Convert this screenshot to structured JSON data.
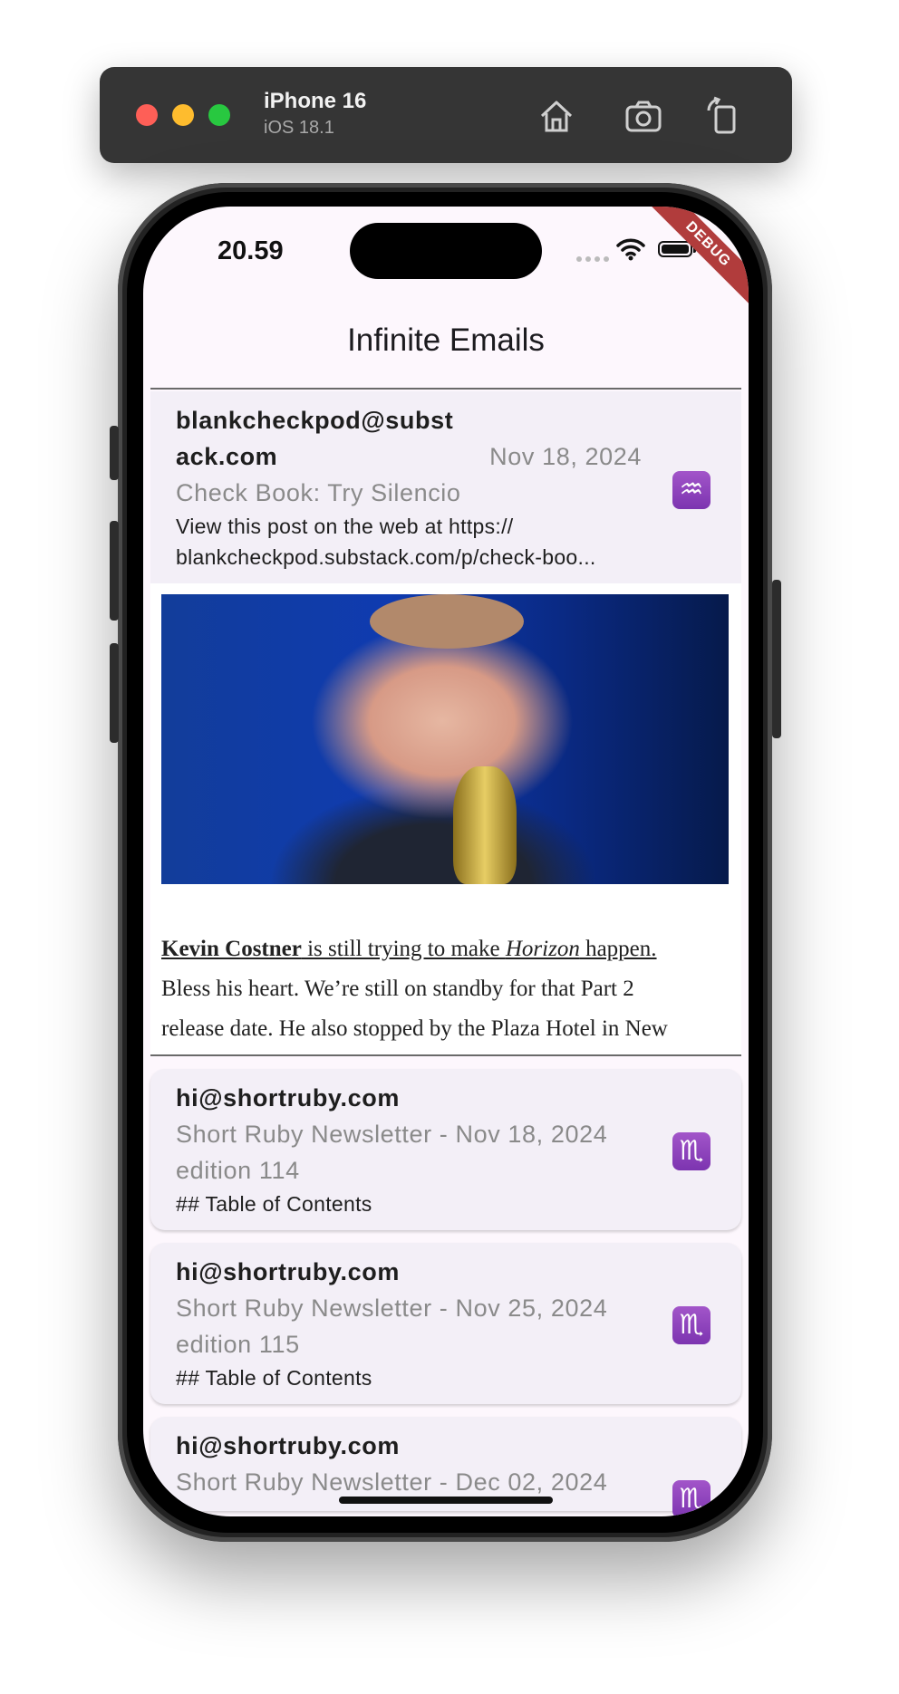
{
  "simulator": {
    "device": "iPhone 16",
    "os": "iOS 18.1"
  },
  "status_bar": {
    "time": "20.59",
    "debug_label": "DEBUG"
  },
  "app": {
    "title": "Infinite Emails"
  },
  "emails": [
    {
      "sender_line1": "blankcheckpod@subst",
      "sender_line2": "ack.com",
      "date": "Nov 18, 2024",
      "subject": "Check Book: Try Silencio",
      "preview_line1": "View this post on the web at https://",
      "preview_line2": "blankcheckpod.substack.com/p/check-boo...",
      "zodiac": "♒",
      "zodiac_icon": "aquarius-icon",
      "expanded": true,
      "article": {
        "strong_link": "Kevin Costner",
        "link_mid": " is still trying to make ",
        "em_link": "Horizon",
        "link_end": " happen.",
        "rest_line1": "Bless his heart. We’re still on standby for that Part 2",
        "rest_line2": "release date. He also stopped by the Plaza Hotel in New"
      }
    },
    {
      "sender": "hi@shortruby.com",
      "subject_line1": "Short Ruby Newsletter - Nov 18, 2024",
      "subject_line2": "edition 114",
      "preview": "## Table of Contents",
      "zodiac": "♏",
      "zodiac_icon": "scorpio-icon"
    },
    {
      "sender": "hi@shortruby.com",
      "subject_line1": "Short Ruby Newsletter - Nov 25, 2024",
      "subject_line2": "edition 115",
      "preview": "## Table of Contents",
      "zodiac": "♏",
      "zodiac_icon": "scorpio-icon"
    },
    {
      "sender": "hi@shortruby.com",
      "subject_line1": "Short Ruby Newsletter - Dec 02, 2024",
      "zodiac": "♏",
      "zodiac_icon": "scorpio-icon"
    }
  ]
}
